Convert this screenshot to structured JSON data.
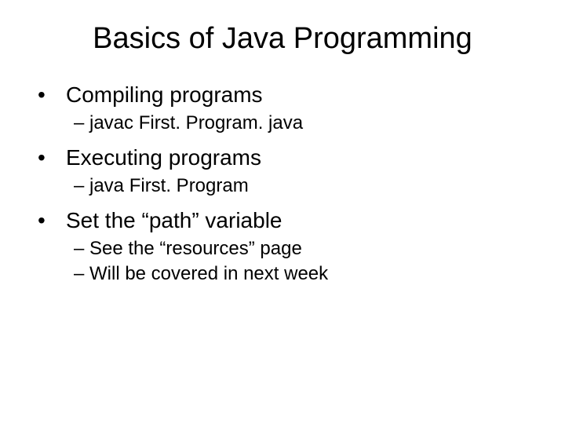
{
  "slide": {
    "title": "Basics of Java Programming",
    "sections": [
      {
        "heading": "Compiling programs",
        "items": [
          "javac First. Program. java"
        ]
      },
      {
        "heading": "Executing programs",
        "items": [
          "java First. Program"
        ]
      },
      {
        "heading": "Set the “path” variable",
        "items": [
          "See the “resources” page",
          "Will be covered in next week"
        ]
      }
    ]
  }
}
